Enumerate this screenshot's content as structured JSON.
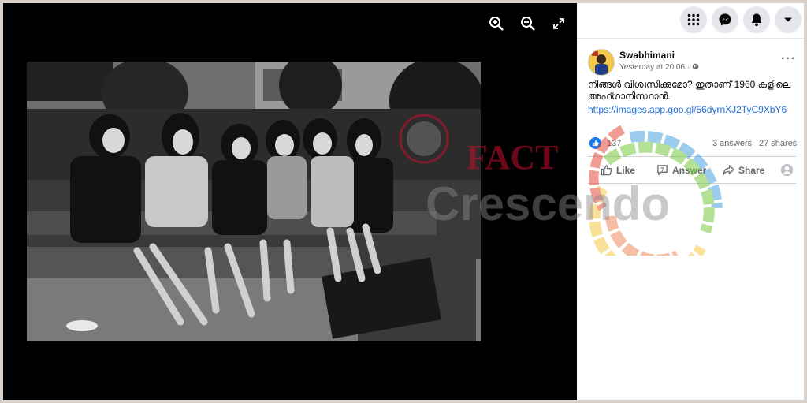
{
  "viewer": {
    "zoom_in_icon": "zoom-in-icon",
    "zoom_out_icon": "zoom-out-icon",
    "fullscreen_icon": "fullscreen-icon"
  },
  "topbar": {
    "icons": [
      "menu-grid-icon",
      "messenger-icon",
      "notifications-bell-icon",
      "account-caret-icon"
    ]
  },
  "post": {
    "author": "Swabhimani",
    "time": "Yesterday at 20:06 ·",
    "text": "നിങ്ങൾ വിശ്വസിക്കുമോ? ഇതാണ് 1960 കളിലെ അഫ്ഗാനിസ്ഥാൻ.",
    "link": "https://images.app.goo.gl/56dyrnXJ2TyC9XbY6",
    "like_count": "137",
    "answers": "3 answers",
    "shares": "27 shares"
  },
  "actions": {
    "like": "Like",
    "answer": "Answer",
    "share": "Share"
  },
  "watermark": {
    "line1": "FACT",
    "line2": "Crescendo"
  },
  "colors": {
    "accent": "#1877f2",
    "link": "#216fdb",
    "watermark_red": "#c8102e"
  }
}
